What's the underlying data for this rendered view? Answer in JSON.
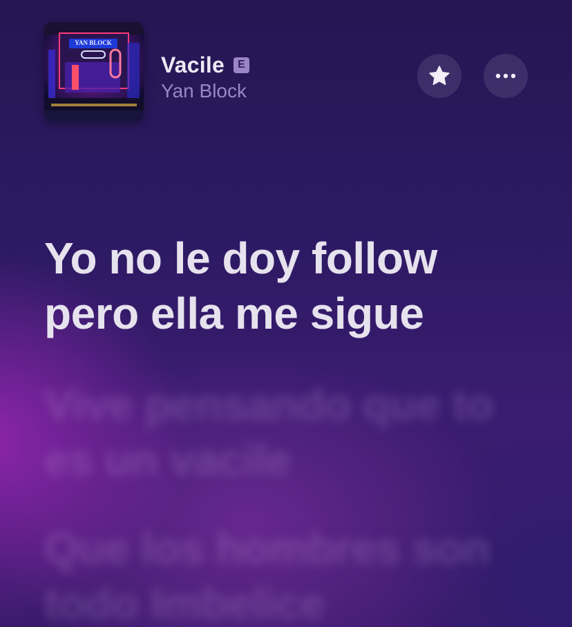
{
  "now_playing": {
    "title": "Vacile",
    "explicit_badge": "E",
    "artist": "Yan Block",
    "cover_sign_text": "YAN BLOCK",
    "favorite_icon": "star-icon",
    "more_icon": "ellipsis-icon"
  },
  "lyrics": {
    "current": "Yo no le doy follow\npero ella me sigue",
    "upcoming": [
      "Vive pensando que to\nes un vacile",
      "Que los hombres son\ntodo Imbelice"
    ]
  },
  "colors": {
    "background_top": "#261653",
    "background_glow": "#aa28be",
    "active_lyric": "#e6e2ee",
    "artist_text": "#9a86c8",
    "explicit_badge": "#9b85c9"
  }
}
